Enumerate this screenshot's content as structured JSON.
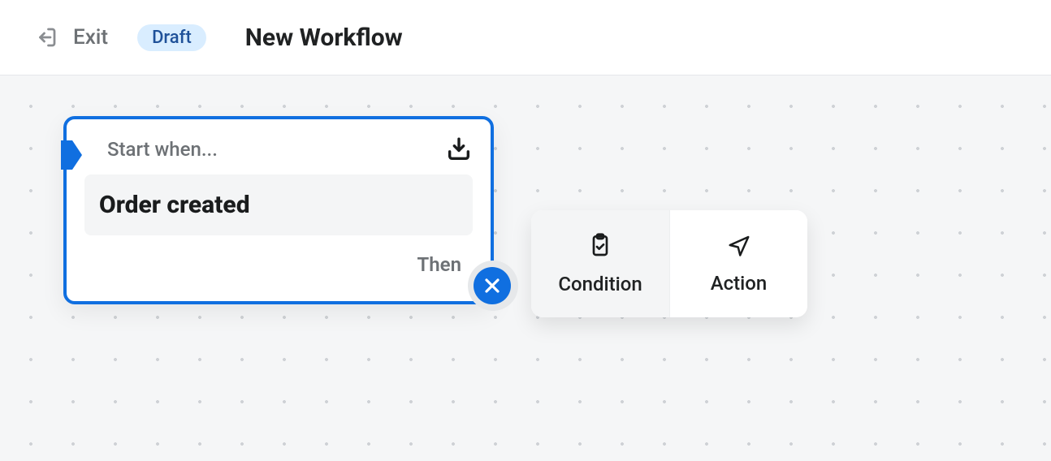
{
  "header": {
    "exit_label": "Exit",
    "status_badge": "Draft",
    "title": "New Workflow"
  },
  "trigger_card": {
    "header_label": "Start when...",
    "trigger_name": "Order created",
    "then_label": "Then"
  },
  "add_chooser": {
    "condition_label": "Condition",
    "action_label": "Action"
  },
  "icons": {
    "exit": "exit-icon",
    "inbox_download": "inbox-download-icon",
    "entry_flag": "entry-flag-icon",
    "close": "close-icon",
    "clipboard_check": "clipboard-check-icon",
    "paper_plane": "paper-plane-icon"
  },
  "colors": {
    "accent": "#106fe0",
    "badge_bg": "#d9edff",
    "canvas_bg": "#f5f6f7"
  }
}
